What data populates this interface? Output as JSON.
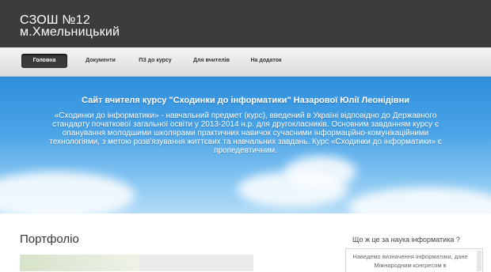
{
  "header": {
    "title_line1": "СЗОШ №12",
    "title_line2": "м.Хмельницький"
  },
  "nav": {
    "items": [
      {
        "label": "Головна",
        "active": true
      },
      {
        "label": "Документи",
        "active": false
      },
      {
        "label": "ПЗ до курсу",
        "active": false
      },
      {
        "label": "Для вчителів",
        "active": false
      },
      {
        "label": "На додаток",
        "active": false
      }
    ]
  },
  "hero": {
    "title": "Сайт вчителя курсу \"Сходинки до інформатики\" Назарової Юлії Леонідівни",
    "body": "«Сходинки до інформатики» - навчальний предмет (курс), введений в Україні відповідно до Державного стандарту початкової загальної освіти у 2013-2014 н.р. для другокласників. Основним завданням курсу є опанування молодшими школярами практичних навичок сучасними інформаційно-комунікаційними технологіями, з метою розв'язування життєвих та навчальних завдань. Курс «Сходинки до інформатики» є пропедевтичним."
  },
  "portfolio": {
    "title": "Портфоліо"
  },
  "sidebar": {
    "title": "Що ж це за наука інформатика ?",
    "text": "Наведемо визначення інформатики, дане Міжнародним конгресом в"
  },
  "colors": {
    "header_bg": "#3a3c3e",
    "nav_active_bg": "#3a3a3a",
    "hero_top": "#2f8fdc",
    "hero_bottom": "#b4dcf7"
  }
}
